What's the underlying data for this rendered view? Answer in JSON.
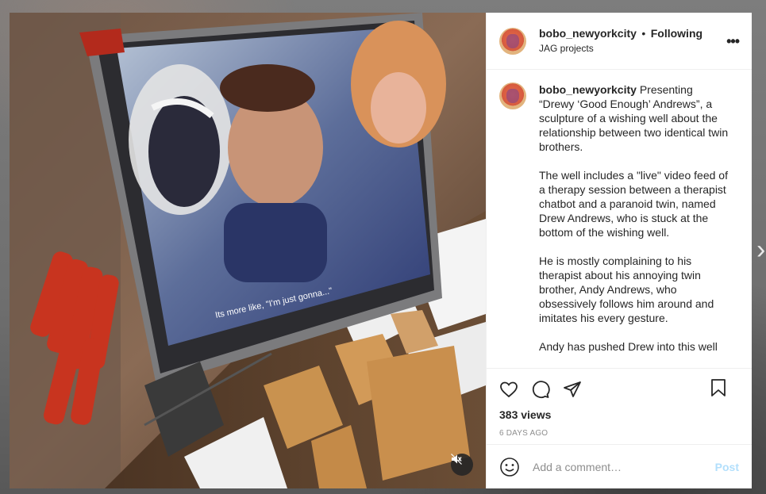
{
  "post": {
    "username": "bobo_newyorkcity",
    "separator": "•",
    "follow_status": "Following",
    "location": "JAG projects",
    "more_label": "•••"
  },
  "caption": {
    "username": "bobo_newyorkcity",
    "text": "Presenting “Drewy ‘Good Enough’ Andrews”, a sculpture of a wishing well about the relationship between two identical twin brothers.\n\nThe well includes a \"live\" video feed of a therapy session between a therapist chatbot and a paranoid twin, named Drew Andrews, who is stuck at the bottom of the wishing well.\n\nHe is mostly complaining to his therapist about his annoying twin brother, Andy Andrews, who obsessively follows him around and imitates his every gesture.\n\nAndy has pushed Drew into this well"
  },
  "stats": {
    "views": "383 views",
    "date": "6 DAYS AGO"
  },
  "comment": {
    "placeholder": "Add a comment…",
    "post_label": "Post"
  },
  "media": {
    "subtitle_text": "Its more like, \"I'm just gonna...\""
  },
  "icons": {
    "like": "heart-icon",
    "comment": "comment-icon",
    "share": "paper-plane-icon",
    "save": "bookmark-icon",
    "emoji": "smiley-icon",
    "mute": "speaker-muted-icon",
    "next": "chevron-right-icon"
  },
  "colors": {
    "post_disabled": "#b2dffc",
    "secondary_text": "#8e8e8e",
    "primary_text": "#262626"
  }
}
